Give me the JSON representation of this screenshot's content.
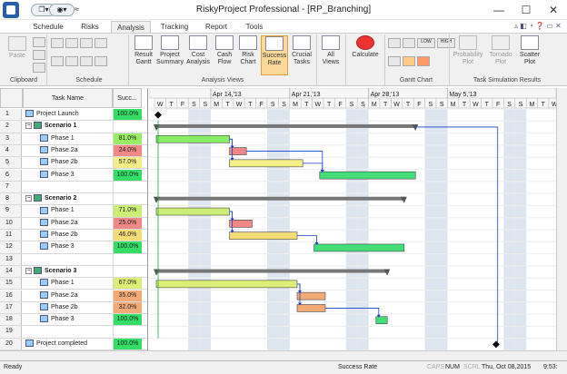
{
  "window": {
    "title": "RiskyProject Professional - [RP_Branching]",
    "controls": [
      "—",
      "☐",
      "✕"
    ]
  },
  "qat": [
    "❐▾",
    "◉▾",
    "≈"
  ],
  "tabs": [
    "Schedule",
    "Risks",
    "Analysis",
    "Tracking",
    "Report",
    "Tools"
  ],
  "active_tab": "Analysis",
  "ribbon": {
    "clipboard": {
      "paste": "Paste",
      "label": "Clipboard"
    },
    "schedule": {
      "label": "Schedule"
    },
    "analysis_views": {
      "label": "Analysis Views",
      "buttons": [
        {
          "l1": "Result",
          "l2": "Gantt"
        },
        {
          "l1": "Project",
          "l2": "Summary"
        },
        {
          "l1": "Cost",
          "l2": "Analysis"
        },
        {
          "l1": "Cash",
          "l2": "Flow"
        },
        {
          "l1": "Risk",
          "l2": "Chart"
        },
        {
          "l1": "Success",
          "l2": "Rate"
        },
        {
          "l1": "Crucial",
          "l2": "Tasks"
        }
      ]
    },
    "all_views": {
      "l1": "All",
      "l2": "Views"
    },
    "calculate": "Calculate",
    "gantt_chart": {
      "label": "Gantt Chart",
      "zoom": [
        "LOW",
        "HIGH"
      ]
    },
    "task_sim": {
      "label": "Task Simulation Results",
      "buttons": [
        {
          "l1": "Probability",
          "l2": "Plot"
        },
        {
          "l1": "Tornado",
          "l2": "Plot"
        },
        {
          "l1": "Scatter",
          "l2": "Plot"
        }
      ]
    }
  },
  "grid": {
    "col_name": "Task Name",
    "col_success": "Succ...",
    "rows": [
      {
        "n": "1",
        "name": "Project Launch",
        "pct": "100.0%",
        "c": "#33dd66",
        "lvl": 0,
        "icon": "task"
      },
      {
        "n": "2",
        "name": "Scenario 1",
        "pct": "",
        "c": "",
        "lvl": 0,
        "icon": "summary"
      },
      {
        "n": "3",
        "name": "Phase 1",
        "pct": "81.0%",
        "c": "#99ee66",
        "lvl": 1,
        "icon": "task"
      },
      {
        "n": "4",
        "name": "Phase 2a",
        "pct": "24.0%",
        "c": "#f08888",
        "lvl": 1,
        "icon": "task"
      },
      {
        "n": "5",
        "name": "Phase 2b",
        "pct": "57.0%",
        "c": "#f4ee88",
        "lvl": 1,
        "icon": "task"
      },
      {
        "n": "6",
        "name": "Phase 3",
        "pct": "100.0%",
        "c": "#33dd66",
        "lvl": 1,
        "icon": "task"
      },
      {
        "n": "7",
        "name": "",
        "pct": "",
        "c": "",
        "lvl": 0,
        "icon": ""
      },
      {
        "n": "8",
        "name": "Scenario 2",
        "pct": "",
        "c": "",
        "lvl": 0,
        "icon": "summary"
      },
      {
        "n": "9",
        "name": "Phase 1",
        "pct": "71.0%",
        "c": "#ccee77",
        "lvl": 1,
        "icon": "task"
      },
      {
        "n": "10",
        "name": "Phase 2a",
        "pct": "25.0%",
        "c": "#f08888",
        "lvl": 1,
        "icon": "task"
      },
      {
        "n": "11",
        "name": "Phase 2b",
        "pct": "46.0%",
        "c": "#f4dd77",
        "lvl": 1,
        "icon": "task"
      },
      {
        "n": "12",
        "name": "Phase 3",
        "pct": "100.0%",
        "c": "#33dd66",
        "lvl": 1,
        "icon": "task"
      },
      {
        "n": "13",
        "name": "",
        "pct": "",
        "c": "",
        "lvl": 0,
        "icon": ""
      },
      {
        "n": "14",
        "name": "Scenario 3",
        "pct": "",
        "c": "",
        "lvl": 0,
        "icon": "summary"
      },
      {
        "n": "15",
        "name": "Phase 1",
        "pct": "67.0%",
        "c": "#ddee77",
        "lvl": 1,
        "icon": "task"
      },
      {
        "n": "16",
        "name": "Phase 2a",
        "pct": "35.0%",
        "c": "#f4aa77",
        "lvl": 1,
        "icon": "task"
      },
      {
        "n": "17",
        "name": "Phase 2b",
        "pct": "32.0%",
        "c": "#f4aa77",
        "lvl": 1,
        "icon": "task"
      },
      {
        "n": "18",
        "name": "Phase 3",
        "pct": "100.0%",
        "c": "#33dd66",
        "lvl": 1,
        "icon": "task"
      },
      {
        "n": "19",
        "name": "",
        "pct": "",
        "c": "",
        "lvl": 0,
        "icon": ""
      },
      {
        "n": "20",
        "name": "Project completed",
        "pct": "100.0%",
        "c": "#33dd66",
        "lvl": 0,
        "icon": "task"
      }
    ]
  },
  "gantt": {
    "weeks": [
      "Apr 14,'13",
      "Apr 21,'13",
      "Apr 28,'13",
      "May 5,'13"
    ],
    "day_letters": [
      "W",
      "T",
      "F",
      "S",
      "S",
      "M",
      "T",
      "W",
      "T",
      "F",
      "S",
      "S",
      "M",
      "T",
      "W",
      "T",
      "F",
      "S",
      "S",
      "M",
      "T",
      "W",
      "T",
      "F",
      "S",
      "S",
      "M",
      "T",
      "W",
      "T",
      "F",
      "S",
      "S",
      "M",
      "T",
      "W"
    ],
    "start_day": 0,
    "tasks": [
      {
        "row": 0,
        "type": "milestone",
        "start": 0
      },
      {
        "row": 1,
        "type": "summary",
        "start": 0,
        "end": 23
      },
      {
        "row": 2,
        "type": "bar",
        "start": 0,
        "end": 6.5,
        "color": "#88ee66"
      },
      {
        "row": 3,
        "type": "bar",
        "start": 6.5,
        "end": 8,
        "color": "#f08888"
      },
      {
        "row": 4,
        "type": "bar",
        "start": 6.5,
        "end": 13,
        "color": "#f4ee88"
      },
      {
        "row": 5,
        "type": "bar",
        "start": 14.5,
        "end": 23,
        "color": "#44dd77"
      },
      {
        "row": 7,
        "type": "summary",
        "start": 0,
        "end": 22
      },
      {
        "row": 8,
        "type": "bar",
        "start": 0,
        "end": 6.5,
        "color": "#ccee77"
      },
      {
        "row": 9,
        "type": "bar",
        "start": 6.5,
        "end": 8.5,
        "color": "#f08888"
      },
      {
        "row": 10,
        "type": "bar",
        "start": 6.5,
        "end": 12.5,
        "color": "#f4dd77"
      },
      {
        "row": 11,
        "type": "bar",
        "start": 14,
        "end": 22,
        "color": "#44dd77"
      },
      {
        "row": 13,
        "type": "summary",
        "start": 0,
        "end": 20.5
      },
      {
        "row": 14,
        "type": "bar",
        "start": 0,
        "end": 12.5,
        "color": "#ddee77"
      },
      {
        "row": 15,
        "type": "bar",
        "start": 12.5,
        "end": 15,
        "color": "#f4aa77"
      },
      {
        "row": 16,
        "type": "bar",
        "start": 12.5,
        "end": 15,
        "color": "#f4aa77"
      },
      {
        "row": 17,
        "type": "bar",
        "start": 19.5,
        "end": 20.5,
        "color": "#44dd77"
      },
      {
        "row": 19,
        "type": "milestone",
        "start": 30
      }
    ]
  },
  "status": {
    "left": "Ready",
    "center": "Success Rate",
    "indicators": [
      "CAPS",
      "NUM",
      "SCRL"
    ],
    "date": "Thu, Oct 08,2015",
    "time": "9:53:"
  }
}
